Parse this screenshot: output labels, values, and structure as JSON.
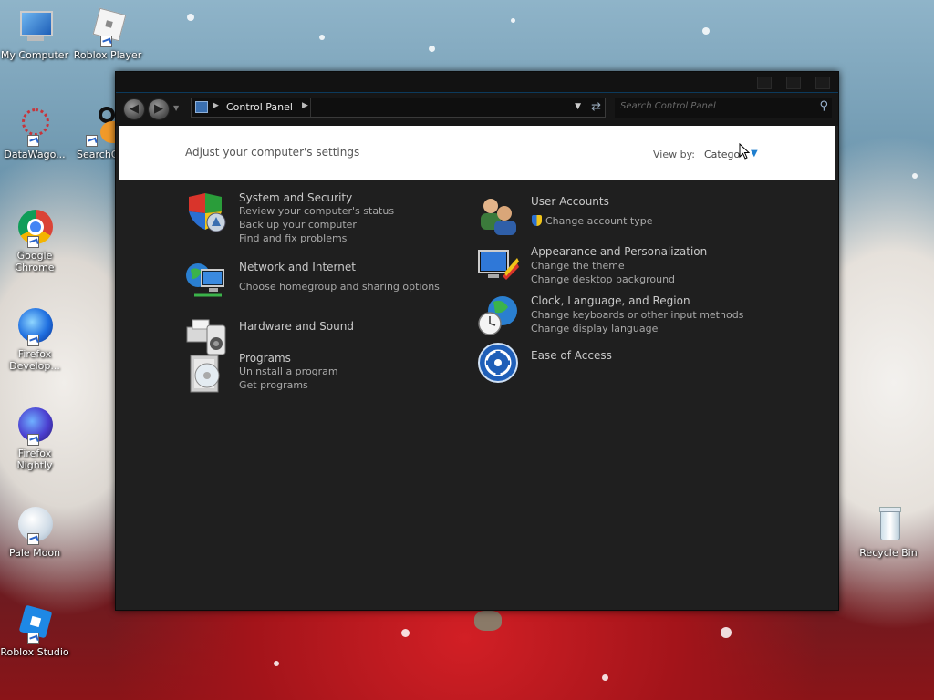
{
  "desktop": {
    "icons": [
      {
        "label": "My Computer"
      },
      {
        "label": "Roblox Player"
      },
      {
        "label": "DataWago..."
      },
      {
        "label": "SearchG..."
      },
      {
        "label": "Google Chrome"
      },
      {
        "label": "Firefox Develop..."
      },
      {
        "label": "Firefox Nightly"
      },
      {
        "label": "Pale Moon"
      },
      {
        "label": "Roblox Studio"
      },
      {
        "label": "Recycle Bin"
      }
    ]
  },
  "window": {
    "breadcrumb": [
      "Control Panel"
    ],
    "search": {
      "placeholder": "Search Control Panel"
    },
    "header": {
      "adjust_text": "Adjust your computer's settings",
      "view_by_label": "View by:",
      "view_by_value": "Catego"
    },
    "categories": [
      {
        "title": "System and Security",
        "links": [
          "Review your computer's status",
          "Back up your computer",
          "Find and fix problems"
        ]
      },
      {
        "title": "Network and Internet",
        "links": [
          "Choose homegroup and sharing options"
        ]
      },
      {
        "title": "Hardware and Sound",
        "links": []
      },
      {
        "title": "Programs",
        "links": [
          "Uninstall a program",
          "Get programs"
        ]
      },
      {
        "title": "User Accounts",
        "links": [
          "Change account type"
        ]
      },
      {
        "title": "Appearance and Personalization",
        "links": [
          "Change the theme",
          "Change desktop background"
        ]
      },
      {
        "title": "Clock, Language, and Region",
        "links": [
          "Change keyboards or other input methods",
          "Change display language"
        ]
      },
      {
        "title": "Ease of Access",
        "links": []
      }
    ]
  },
  "colors": {
    "window_bg": "#1f1f1f",
    "header_band": "#ffffff",
    "link_text": "#a9a9a9",
    "accent": "#1f7fcf"
  }
}
